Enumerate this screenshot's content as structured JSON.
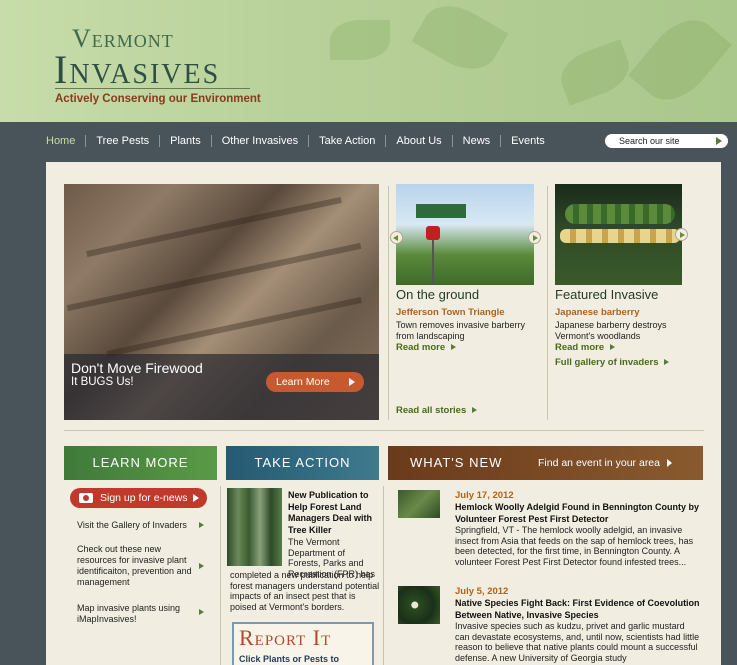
{
  "brand": {
    "name_top": "Vermont",
    "name_main": "Invasives",
    "tagline": "Actively Conserving our Environment"
  },
  "nav": {
    "items": [
      "Home",
      "Tree Pests",
      "Plants",
      "Other Invasives",
      "Take Action",
      "About Us",
      "News",
      "Events"
    ],
    "search_placeholder": "Search our site"
  },
  "hero": {
    "title": "Don't Move Firewood",
    "subtitle": "It BUGS Us!",
    "button": "Learn More"
  },
  "on_the_ground": {
    "title": "On the ground",
    "subtitle": "Jefferson Town Triangle",
    "text": "Town removes invasive barberry from landscaping",
    "read_more": "Read more",
    "read_all": "Read all stories"
  },
  "featured": {
    "title": "Featured Invasive",
    "subtitle": "Japanese barberry",
    "text": "Japanese barberry destroys Vermont's woodlands",
    "read_more": "Read more",
    "gallery": "Full gallery of invaders"
  },
  "bands": {
    "learn_more": "LEARN MORE",
    "take_action": "TAKE ACTION",
    "whats_new": "WHAT'S NEW",
    "find_event": "Find an event in your area"
  },
  "learn_more": {
    "enews": "Sign up for e-news",
    "items": [
      "Visit the Gallery of Invaders",
      "Check out these new resources for invasive plant identificaiton, prevention and management",
      "Map invasive plants using iMapInvasives!"
    ]
  },
  "take_action": {
    "title": "New Publication to Help Forest Land Managers Deal with Tree Killer",
    "body_right": "The Vermont Department of Forests, Parks and Recreation (FPR) has",
    "body_full": "completed a new publication to help forest managers understand potential impacts of an insect pest that is poised at Vermont's borders.",
    "report_title": "Report It",
    "report_sub": "Click Plants or Pests to"
  },
  "news": [
    {
      "date": "July 17, 2012",
      "title": "Hemlock Woolly Adelgid Found in Bennington County by Volunteer Forest Pest First Detector",
      "body": "Springfield, VT - The hemlock woolly adelgid, an invasive insect from Asia that feeds on the sap of hemlock trees, has been detected, for the first time, in Bennington County. A volunteer Forest Pest First Detector found infested trees..."
    },
    {
      "date": "July 5, 2012",
      "title": "Native Species Fight Back: First Evidence of Coevolution Between Native, Invasive Species",
      "body": "Invasive species such as kudzu, privet and garlic mustard can devastate ecosystems, and, until now, scientists had little reason to believe that native plants could mount a successful defense. A new University of Georgia study"
    }
  ],
  "colors": {
    "nav_bg": "#48545a",
    "header_green": "#b8d19a",
    "accent_orange": "#b0631a",
    "link_green": "#4a6a1a",
    "enews_red": "#c0392b"
  }
}
